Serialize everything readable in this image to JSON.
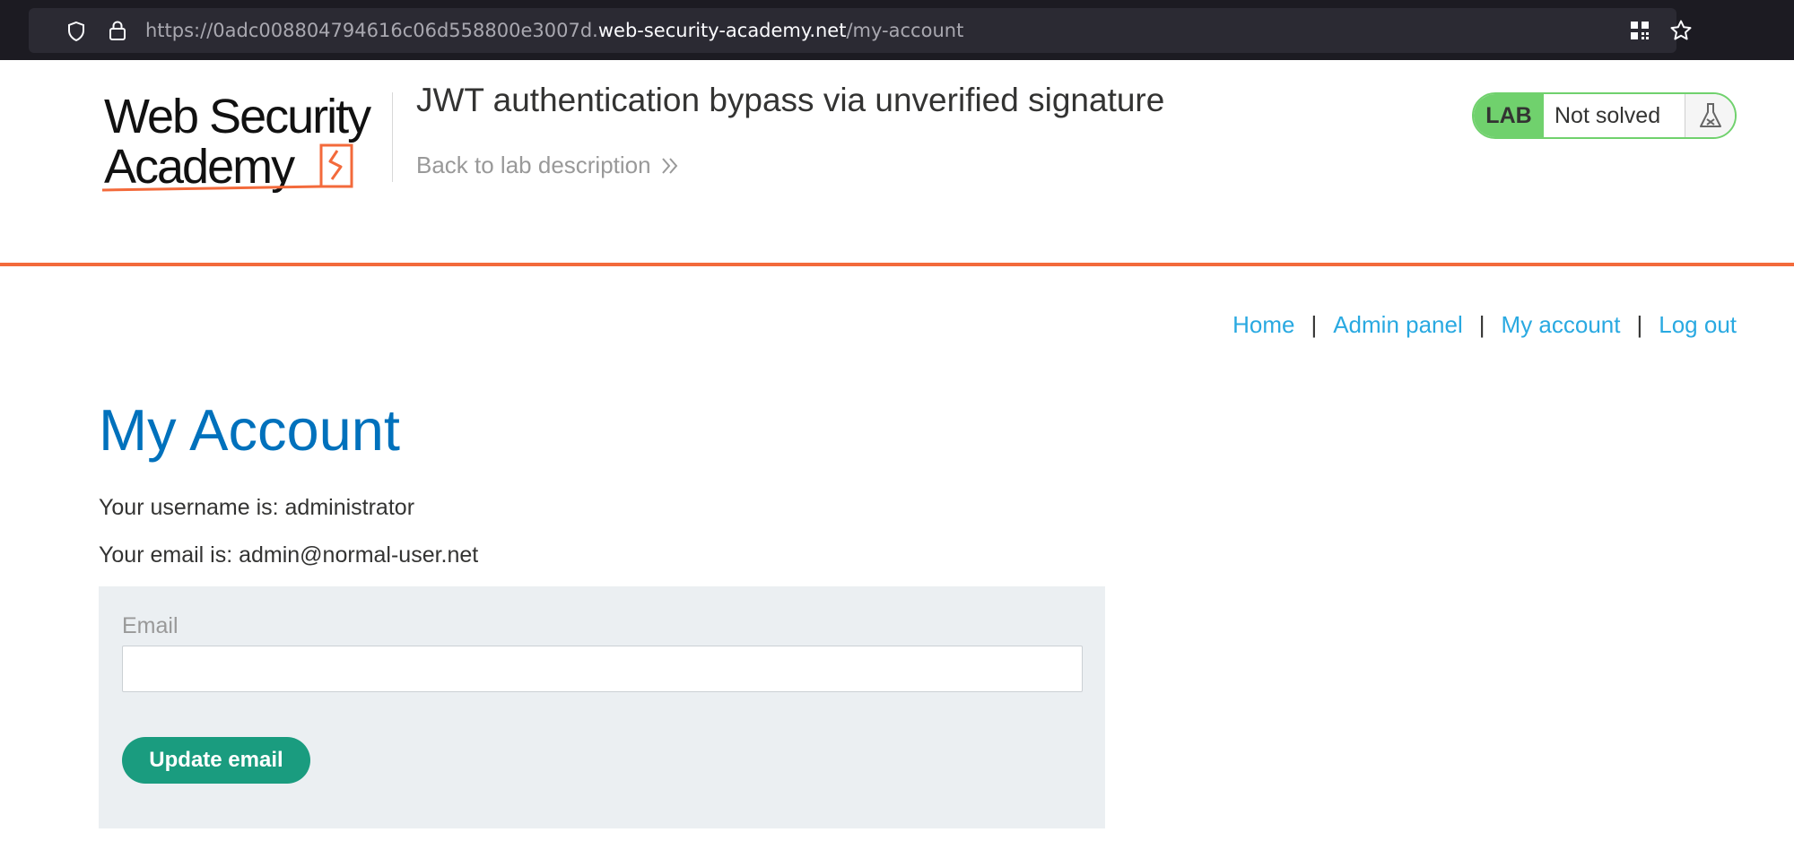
{
  "browser": {
    "url_prefix": "https://0adc008804794616c06d558800e3007d.",
    "url_domain": "web-security-academy.net",
    "url_path": "/my-account"
  },
  "header": {
    "logo_text": "Web Security Academy",
    "lab_title": "JWT authentication bypass via unverified signature",
    "back_link": "Back to lab description",
    "lab_badge": "LAB",
    "lab_status": "Not solved"
  },
  "nav": {
    "items": [
      "Home",
      "Admin panel",
      "My account",
      "Log out"
    ],
    "separator": "|"
  },
  "main": {
    "title": "My Account",
    "username_line": "Your username is: administrator",
    "email_line": "Your email is: admin@normal-user.net",
    "form": {
      "email_label": "Email",
      "email_value": "",
      "submit_label": "Update email"
    }
  },
  "colors": {
    "accent_orange": "#f36a3b",
    "lab_green": "#70d16d",
    "link_blue": "#29a9e1",
    "title_blue": "#0071bc",
    "button_green": "#1a9c7f"
  },
  "icons": [
    "shield-icon",
    "lock-icon",
    "qr-code-icon",
    "bookmark-star-icon",
    "double-chevron-right-icon",
    "flask-icon"
  ]
}
